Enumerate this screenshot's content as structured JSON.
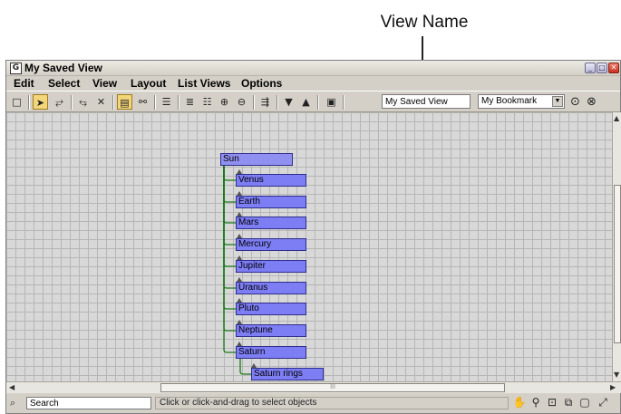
{
  "callout": {
    "label": "View Name"
  },
  "window": {
    "title": "My Saved View",
    "app_icon": "G",
    "controls": [
      "_",
      "□",
      "✕"
    ]
  },
  "menu": [
    "Edit",
    "Select",
    "View",
    "Layout",
    "List Views",
    "Options"
  ],
  "toolbar": {
    "view_name_value": "My Saved View",
    "bookmark_value": "My Bookmark"
  },
  "graph": {
    "root": "Sun",
    "children": [
      "Venus",
      "Earth",
      "Mars",
      "Mercury",
      "Jupiter",
      "Uranus",
      "Pluto",
      "Neptune",
      "Saturn"
    ],
    "grandchild": "Saturn rings"
  },
  "status": {
    "search_label": "Search",
    "hint": "Click or click-and-drag to select objects"
  },
  "scrollbar": {
    "thumb_mark": "III"
  },
  "colors": {
    "node_fill": "#7d7df4",
    "link_color": "#1a7a1a",
    "titlebar_close": "#c83020"
  }
}
